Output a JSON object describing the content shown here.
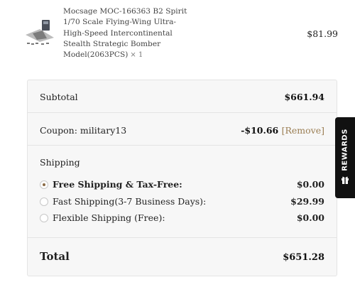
{
  "product": {
    "name": "Mocsage MOC-166363 B2 Spirit 1/70 Scale Flying-Wing Ultra-High-Speed Intercontinental Stealth Strategic Bomber Model(2063PCS)",
    "quantity": "× 1",
    "price": "$81.99",
    "icon": "bomber-model-thumbnail"
  },
  "summary": {
    "subtotal_label": "Subtotal",
    "subtotal_value": "$661.94",
    "coupon_label": "Coupon: military13",
    "coupon_value": "-$10.66",
    "coupon_remove": "[Remove]",
    "shipping_title": "Shipping",
    "shipping_options": [
      {
        "label": "Free Shipping & Tax-Free:",
        "price": "$0.00",
        "selected": true
      },
      {
        "label": "Fast Shipping(3-7 Business Days):",
        "price": "$29.99",
        "selected": false
      },
      {
        "label": "Flexible Shipping (Free):",
        "price": "$0.00",
        "selected": false
      }
    ],
    "total_label": "Total",
    "total_value": "$651.28"
  },
  "rewards": {
    "label": "REWARDS",
    "icon": "gift-icon",
    "background": "#111111"
  },
  "colors": {
    "accent": "#9a7d52",
    "panel_background": "#f7f7f7"
  }
}
